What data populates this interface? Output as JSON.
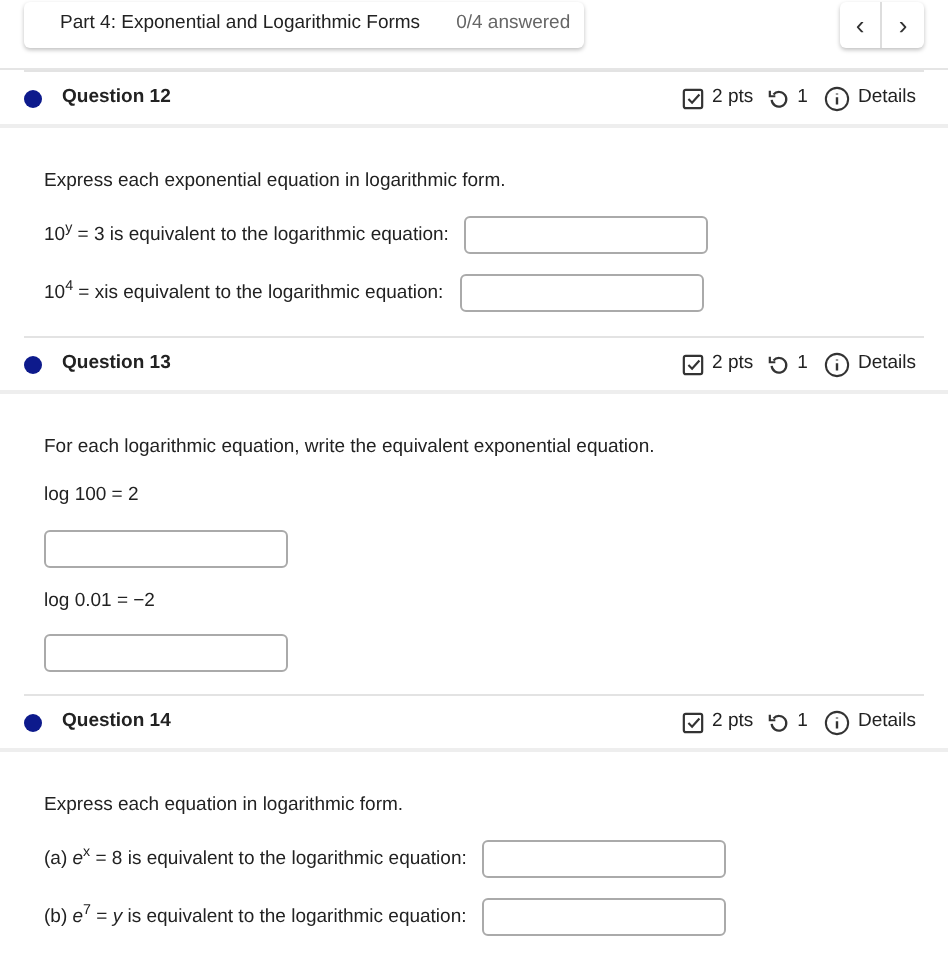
{
  "part_bar": {
    "title": "Part 4: Exponential and Logarithmic Forms",
    "progress": "0/4 answered",
    "prev": "‹",
    "next": "›"
  },
  "questions": [
    {
      "title": "Question 12",
      "points": "2 pts",
      "attempts": "1",
      "details": "Details",
      "instruction": "Express each exponential equation in logarithmic form.",
      "items": [
        {
          "kind": "inline",
          "text": "10$^{y}$ = 3 is equivalent to the logarithmic equation:"
        },
        {
          "kind": "inline",
          "text": "10$^{4}$ = xis equivalent to the logarithmic equation:"
        }
      ]
    },
    {
      "title": "Question 13",
      "points": "2 pts",
      "attempts": "1",
      "details": "Details",
      "instruction": "For each logarithmic equation, write the equivalent exponential equation.",
      "items": [
        {
          "kind": "below",
          "text": "log 100 = 2"
        },
        {
          "kind": "below",
          "text": "log 0.01 = −2"
        }
      ]
    },
    {
      "title": "Question 14",
      "points": "2 pts",
      "attempts": "1",
      "details": "Details",
      "instruction": "Express each equation in logarithmic form.",
      "items": [
        {
          "kind": "inline",
          "text": "(a) *e*$^{x}$ = 8 is equivalent to the logarithmic equation:"
        },
        {
          "kind": "inline",
          "text": "(b) *e*$^{7}$ = *y* is equivalent to the logarithmic equation:"
        }
      ]
    }
  ]
}
